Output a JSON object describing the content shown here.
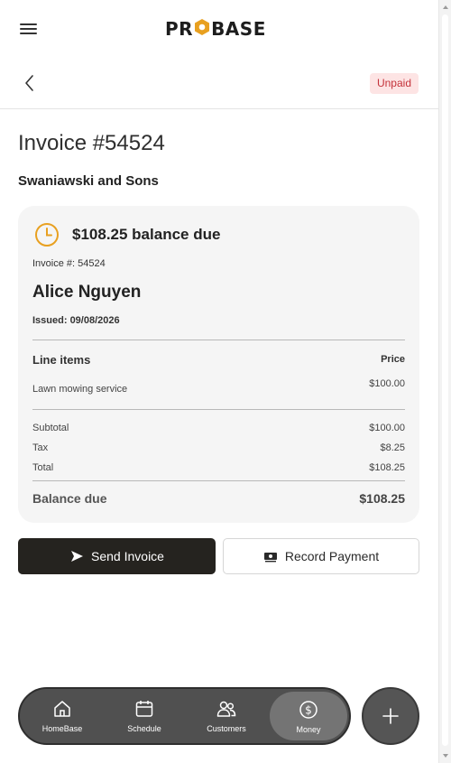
{
  "app": {
    "logo_text_before": "PR",
    "logo_text_after": "BASE"
  },
  "header": {
    "status_badge": "Unpaid"
  },
  "invoice": {
    "title": "Invoice #54524",
    "company": "Swaniawski and Sons",
    "balance_due_heading": "$108.25 balance due",
    "invoice_number_line": "Invoice #: 54524",
    "customer_name": "Alice Nguyen",
    "issued_line": "Issued: 09/08/2026",
    "line_items_header": "Line items",
    "price_header": "Price",
    "line_items": [
      {
        "name": "Lawn mowing service",
        "price": "$100.00"
      }
    ],
    "summary": [
      {
        "label": "Subtotal",
        "value": "$100.00"
      },
      {
        "label": "Tax",
        "value": "$8.25"
      },
      {
        "label": "Total",
        "value": "$108.25"
      }
    ],
    "balance_label": "Balance due",
    "balance_value": "$108.25"
  },
  "actions": {
    "send_label": "Send Invoice",
    "record_label": "Record Payment"
  },
  "nav": {
    "items": [
      {
        "label": "HomeBase",
        "icon": "home-icon"
      },
      {
        "label": "Schedule",
        "icon": "calendar-icon"
      },
      {
        "label": "Customers",
        "icon": "users-icon"
      },
      {
        "label": "Money",
        "icon": "dollar-icon",
        "active": true
      }
    ]
  },
  "colors": {
    "accent_orange": "#e8a020",
    "badge_bg": "#fde4e4",
    "badge_text": "#c4323a",
    "primary_button": "#25231f",
    "nav_bg": "#505050"
  }
}
